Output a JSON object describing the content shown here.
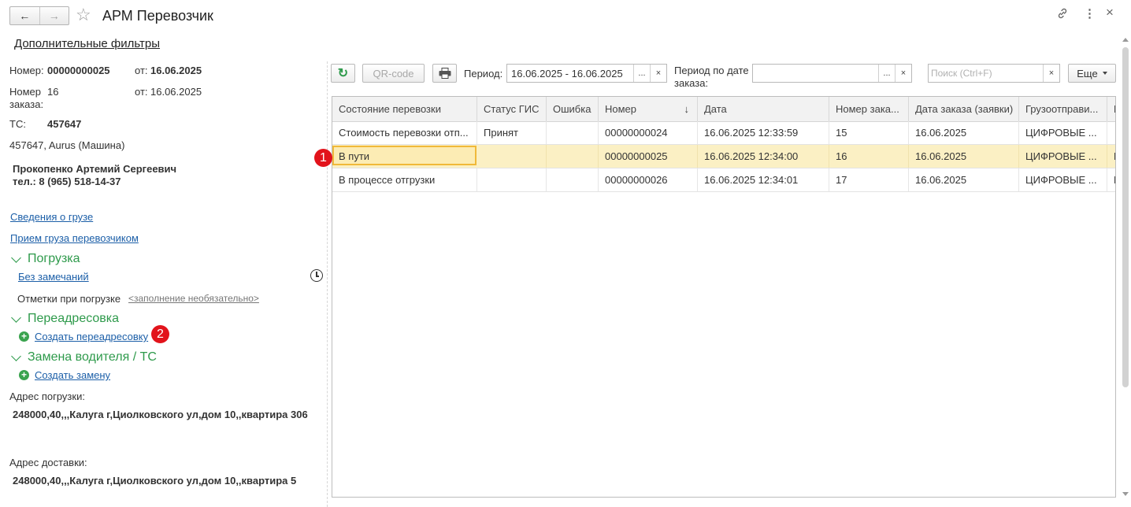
{
  "window": {
    "title": "АРМ Перевозчик",
    "back_icon": "←",
    "forward_icon": "→",
    "star_icon": "☆",
    "link_icon": "🔗",
    "menu_icon": "⋮",
    "close_icon": "×"
  },
  "filters_link": "Дополнительные фильтры",
  "left": {
    "number_label": "Номер:",
    "number_value": "00000000025",
    "from_label": "от:",
    "number_date": "16.06.2025",
    "order_label_1": "Номер",
    "order_label_2": "заказа:",
    "order_value": "16",
    "order_from_label": "от:",
    "order_date": "16.06.2025",
    "ts_label": "ТС:",
    "ts_value": "457647",
    "vehicle": "457647, Aurus (Машина)",
    "driver_name": "Прокопенко Артемий Сергеевич",
    "driver_phone": "тел.: 8 (965) 518-14-37",
    "cargo_info_link": "Сведения о грузе",
    "cargo_accept_link": "Прием груза перевозчиком",
    "loading_group": "Погрузка",
    "no_remarks_link": "Без замечаний",
    "loading_marks_label": "Отметки при погрузке",
    "loading_marks_hint": "<заполнение необязательно>",
    "readdress_group": "Переадресовка",
    "create_readdress_link": "Создать переадресовку",
    "replace_group": "Замена водителя / ТС",
    "create_replace_link": "Создать замену",
    "loading_address_label": "Адрес погрузки:",
    "loading_address": "248000,40,,,Калуга г,Циолковского ул,дом 10,,квартира 306",
    "delivery_address_label": "Адрес доставки:",
    "delivery_address": "248000,40,,,Калуга г,Циолковского ул,дом 10,,квартира 5"
  },
  "badges": {
    "first": "1",
    "second": "2"
  },
  "toolbar": {
    "refresh_icon": "↻",
    "qr_label": "QR-code",
    "print_icon": "🖶",
    "period_label": "Период:",
    "period_value": "16.06.2025 - 16.06.2025",
    "period_select": "...",
    "period_clear": "×",
    "order_period_label_1": "Период по дате",
    "order_period_label_2": "заказа:",
    "order_period_value": "",
    "order_period_select": "...",
    "order_period_clear": "×",
    "search_placeholder": "Поиск (Ctrl+F)",
    "search_clear": "×",
    "more_label": "Еще"
  },
  "table": {
    "sort_icon": "↓",
    "columns": [
      "Состояние перевозки",
      "Статус ГИС",
      "Ошибка",
      "Номер",
      "Дата",
      "Номер зака...",
      "Дата заказа (заявки)",
      "Грузоотправи...",
      "П"
    ],
    "rows": [
      [
        "Стоимость перевозки отп...",
        "Принят",
        "",
        "00000000024",
        "16.06.2025 12:33:59",
        "15",
        "16.06.2025",
        "ЦИФРОВЫЕ ...",
        ""
      ],
      [
        "В пути",
        "",
        "",
        "00000000025",
        "16.06.2025 12:34:00",
        "16",
        "16.06.2025",
        "ЦИФРОВЫЕ ...",
        "L"
      ],
      [
        "В процессе отгрузки",
        "",
        "",
        "00000000026",
        "16.06.2025 12:34:01",
        "17",
        "16.06.2025",
        "ЦИФРОВЫЕ ...",
        "L"
      ]
    ],
    "selected_row": 1
  },
  "colors": {
    "accent_green": "#2e9a4b",
    "link_blue": "#1c5fa8",
    "selection": "#fbf0c4",
    "badge_red": "#e2131b"
  }
}
